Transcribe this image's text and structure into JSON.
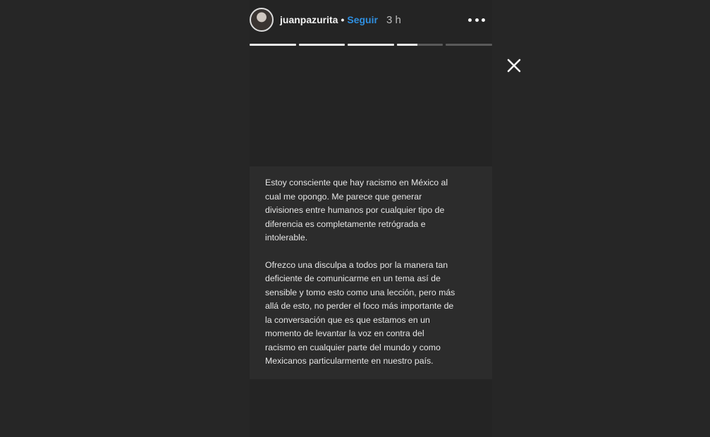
{
  "story": {
    "username": "juanpazurita",
    "separator": "•",
    "follow_label": "Seguir",
    "time": "3 h",
    "progress": [
      1,
      1,
      1,
      0.45,
      0
    ],
    "colors": {
      "follow": "#2f8fe0",
      "background": "#262626"
    },
    "icons": {
      "more": "more-horizontal-icon",
      "close": "close-icon"
    }
  },
  "statement": {
    "paragraph1": "Estoy consciente que hay racismo en México al\ncual me opongo. Me parece que generar\ndivisiones entre humanos por cualquier tipo de\ndiferencia es completamente retrógrada e\nintolerable.",
    "paragraph2": "Ofrezco una disculpa a todos por la manera tan\ndeficiente de comunicarme en un tema así de\nsensible y tomo esto como una lección, pero más\nallá de esto, no perder el foco más importante de\nla conversación que es que estamos en un\nmomento de levantar la voz en contra del\nracismo en cualquier parte del mundo y como\nMexicanos particularmente en nuestro país."
  }
}
